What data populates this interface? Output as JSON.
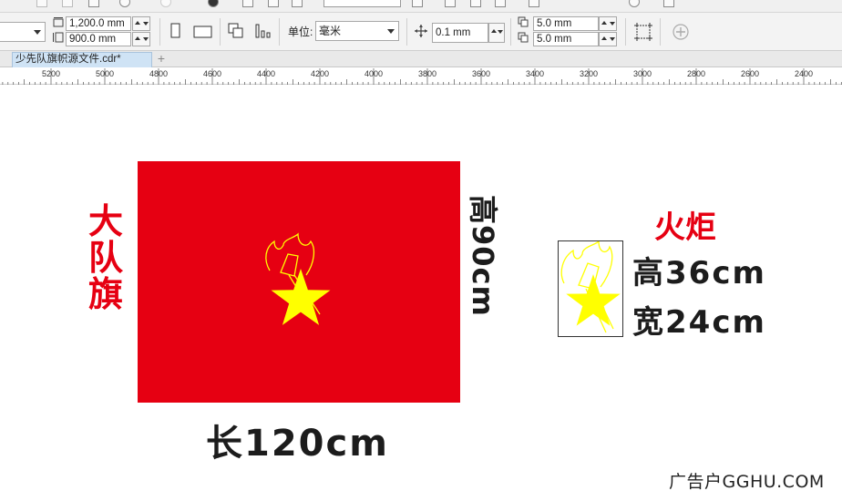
{
  "property_bar": {
    "width_value": "1,200.0 mm",
    "height_value": "900.0 mm",
    "units_label": "单位:",
    "units_value": "毫米",
    "nudge_value": "0.1 mm",
    "dup_x_value": "5.0 mm",
    "dup_y_value": "5.0 mm"
  },
  "document_tab": {
    "title": "少先队旗帜源文件.cdr*"
  },
  "ruler": {
    "labels": [
      "5200",
      "5000",
      "4800",
      "4600",
      "4400",
      "4200",
      "4000",
      "3800",
      "3600",
      "3400",
      "3200",
      "3000",
      "2800",
      "2600",
      "2400"
    ]
  },
  "canvas": {
    "flag_label": "大\n队\n旗",
    "flag_width_label": "长120cm",
    "flag_height_label": "高90cm",
    "torch_title": "火炬",
    "torch_height_label": "高36cm",
    "torch_width_label": "宽24cm"
  },
  "watermark": "广告户GGHU.COM",
  "colors": {
    "flag_red": "#e60012",
    "star_yellow": "#ffff00",
    "label_dark": "#1c1c1c",
    "tab_active": "#cfe3f5"
  }
}
